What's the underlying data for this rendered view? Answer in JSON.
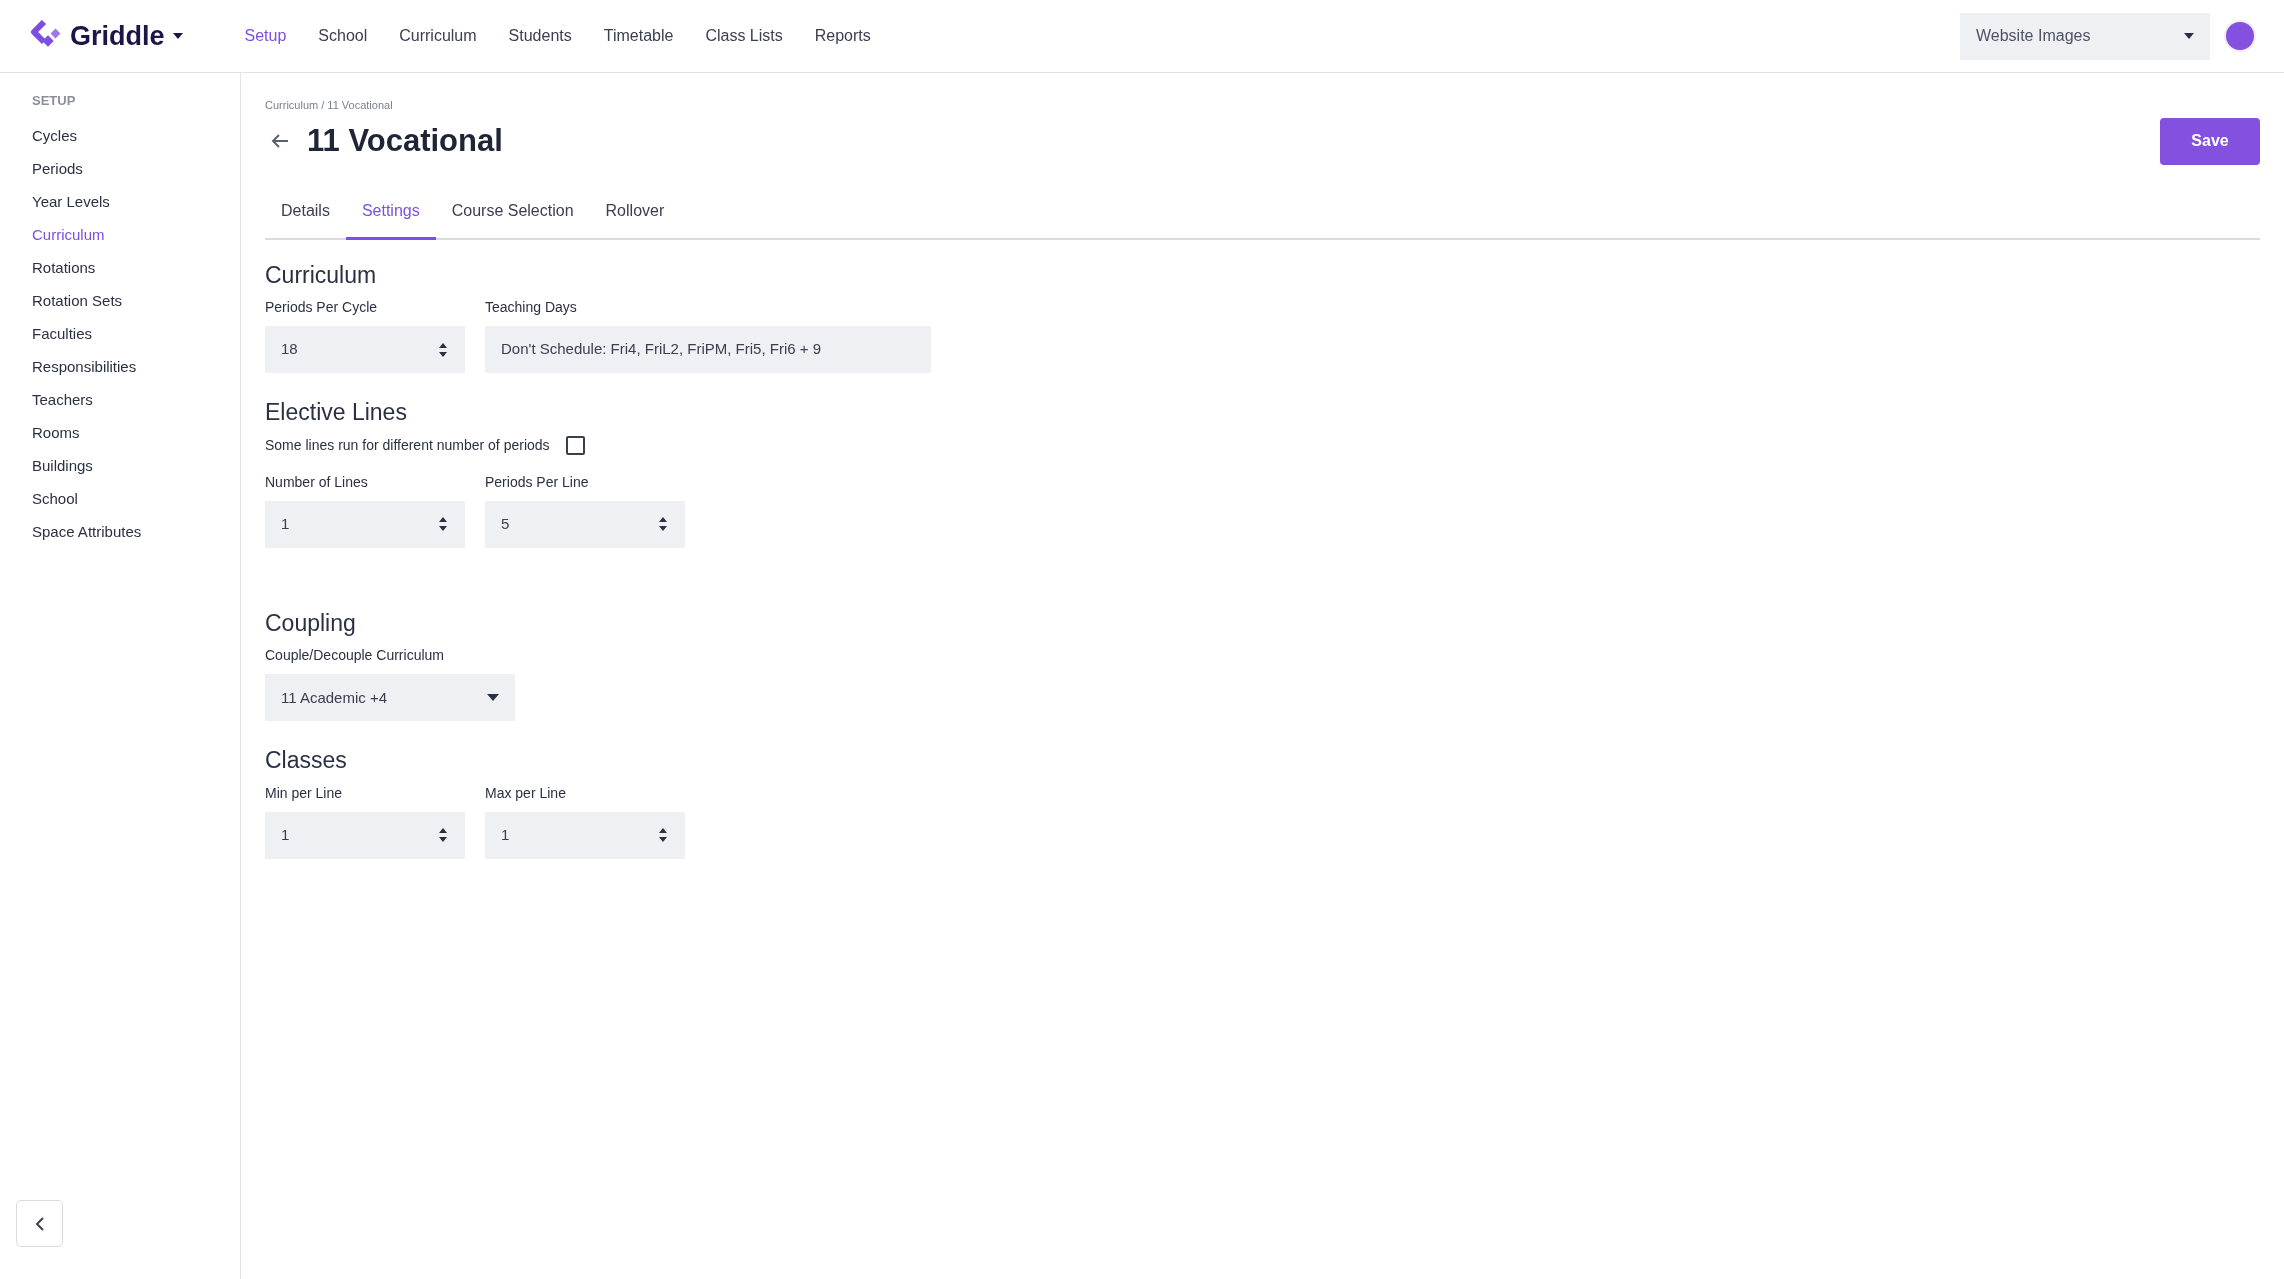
{
  "brand": {
    "name": "Griddle"
  },
  "top_nav": [
    {
      "label": "Setup",
      "selected": true
    },
    {
      "label": "School",
      "selected": false
    },
    {
      "label": "Curriculum",
      "selected": false
    },
    {
      "label": "Students",
      "selected": false
    },
    {
      "label": "Timetable",
      "selected": false
    },
    {
      "label": "Class Lists",
      "selected": false
    },
    {
      "label": "Reports",
      "selected": false
    }
  ],
  "workspace_select": {
    "value": "Website Images"
  },
  "sidebar": {
    "heading": "SETUP",
    "items": [
      {
        "label": "Cycles",
        "selected": false
      },
      {
        "label": "Periods",
        "selected": false
      },
      {
        "label": "Year Levels",
        "selected": false
      },
      {
        "label": "Curriculum",
        "selected": true
      },
      {
        "label": "Rotations",
        "selected": false
      },
      {
        "label": "Rotation Sets",
        "selected": false
      },
      {
        "label": "Faculties",
        "selected": false
      },
      {
        "label": "Responsibilities",
        "selected": false
      },
      {
        "label": "Teachers",
        "selected": false
      },
      {
        "label": "Rooms",
        "selected": false
      },
      {
        "label": "Buildings",
        "selected": false
      },
      {
        "label": "School",
        "selected": false
      },
      {
        "label": "Space Attributes",
        "selected": false
      }
    ]
  },
  "breadcrumb": "Curriculum / 11 Vocational",
  "title": "11 Vocational",
  "save_button": "Save",
  "tabs": [
    {
      "label": "Details",
      "selected": false
    },
    {
      "label": "Settings",
      "selected": true
    },
    {
      "label": "Course Selection",
      "selected": false
    },
    {
      "label": "Rollover",
      "selected": false
    }
  ],
  "sections": [
    {
      "title": "Curriculum",
      "fields": [
        {
          "kind": "number",
          "label": "Periods Per Cycle",
          "value": "18"
        },
        {
          "kind": "text",
          "label": "Teaching Days",
          "value": "Don't Schedule: Fri4, FriL2, FriPM, Fri5, Fri6 + 9"
        }
      ]
    },
    {
      "title": "Elective Lines",
      "checkbox": {
        "label": "Some lines run for different number of periods",
        "checked": false
      },
      "fields": [
        {
          "kind": "number",
          "label": "Number of Lines",
          "value": "1"
        },
        {
          "kind": "number",
          "label": "Periods Per Line",
          "value": "5"
        }
      ]
    },
    {
      "title": "Coupling",
      "fields": [
        {
          "kind": "select",
          "label": "Couple/Decouple Curriculum",
          "value": "11 Academic +4"
        }
      ]
    },
    {
      "title": "Classes",
      "fields": [
        {
          "kind": "number",
          "label": "Min per Line",
          "value": "1"
        },
        {
          "kind": "number",
          "label": "Max per Line",
          "value": "1"
        }
      ]
    }
  ]
}
